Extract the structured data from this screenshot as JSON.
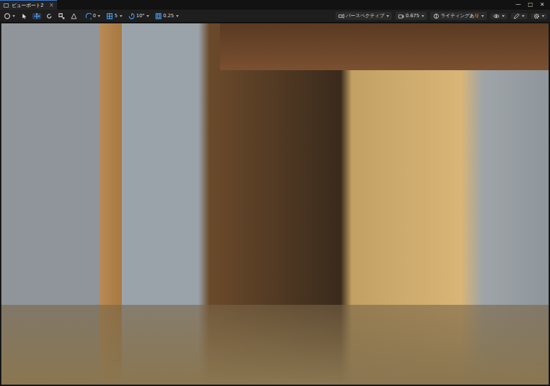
{
  "window": {
    "tab": "ビューポート2",
    "tab_close": "×",
    "controls": [
      "—",
      "□",
      "✕"
    ]
  },
  "toolbar": {
    "tools": [
      {
        "kind": "select",
        "selected": false
      },
      {
        "kind": "move",
        "selected": true
      },
      {
        "kind": "rotate",
        "selected": false
      },
      {
        "kind": "scale",
        "selected": false
      }
    ],
    "snaps": [
      {
        "kind": "surface",
        "value": "0",
        "on": true
      },
      {
        "kind": "grid",
        "value": "5",
        "on": true
      },
      {
        "kind": "angle",
        "value": "10°",
        "on": true
      },
      {
        "kind": "scale",
        "value": "0.25",
        "on": true
      }
    ],
    "view_mode": "パースペクティブ",
    "camera_speed": "0.675",
    "lighting": "ライティングあり"
  }
}
